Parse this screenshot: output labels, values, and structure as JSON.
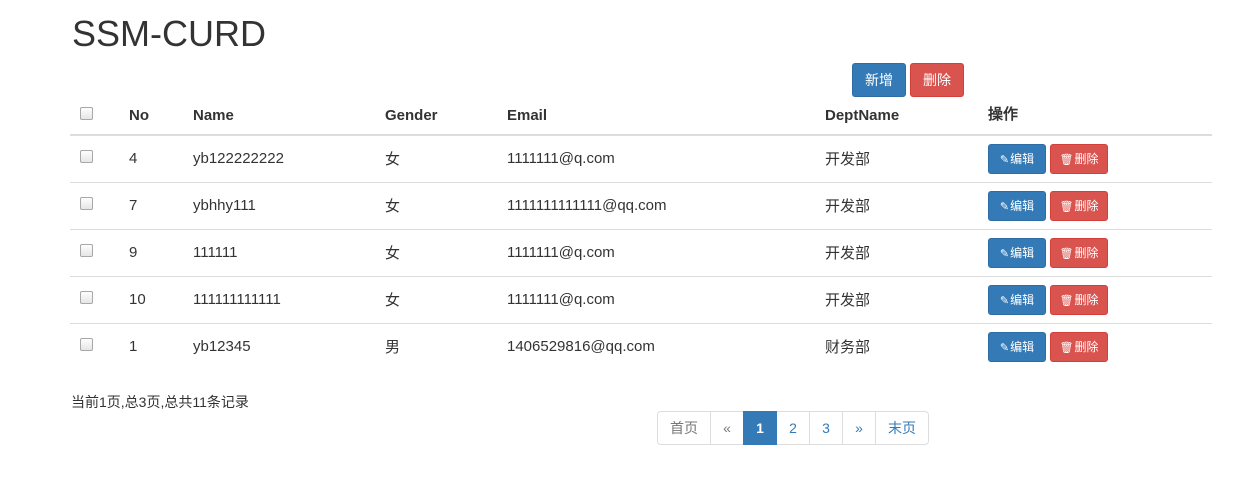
{
  "header": {
    "title": "SSM-CURD"
  },
  "toolbar": {
    "add_label": "新增",
    "delete_label": "删除"
  },
  "table": {
    "columns": [
      "No",
      "Name",
      "Gender",
      "Email",
      "DeptName",
      "操作"
    ],
    "rows": [
      {
        "no": "4",
        "name": "yb122222222",
        "gender": "女",
        "email": "1111111@q.com",
        "dept": "开发部"
      },
      {
        "no": "7",
        "name": "ybhhy111",
        "gender": "女",
        "email": "1111111111111@qq.com",
        "dept": "开发部"
      },
      {
        "no": "9",
        "name": "111111",
        "gender": "女",
        "email": "1111111@q.com",
        "dept": "开发部"
      },
      {
        "no": "10",
        "name": "111111111111",
        "gender": "女",
        "email": "1111111@q.com",
        "dept": "开发部"
      },
      {
        "no": "1",
        "name": "yb12345",
        "gender": "男",
        "email": "1406529816@qq.com",
        "dept": "财务部"
      }
    ],
    "row_actions": {
      "edit_label": "编辑",
      "delete_label": "删除",
      "edit_icon": "pencil-icon",
      "delete_icon": "trash-icon"
    }
  },
  "pagination": {
    "info": "当前1页,总3页,总共11条记录",
    "first": "首页",
    "prev": "«",
    "pages": [
      "1",
      "2",
      "3"
    ],
    "active_page": "1",
    "next": "»",
    "last": "末页"
  },
  "colors": {
    "primary": "#337ab7",
    "danger": "#d9534f"
  }
}
